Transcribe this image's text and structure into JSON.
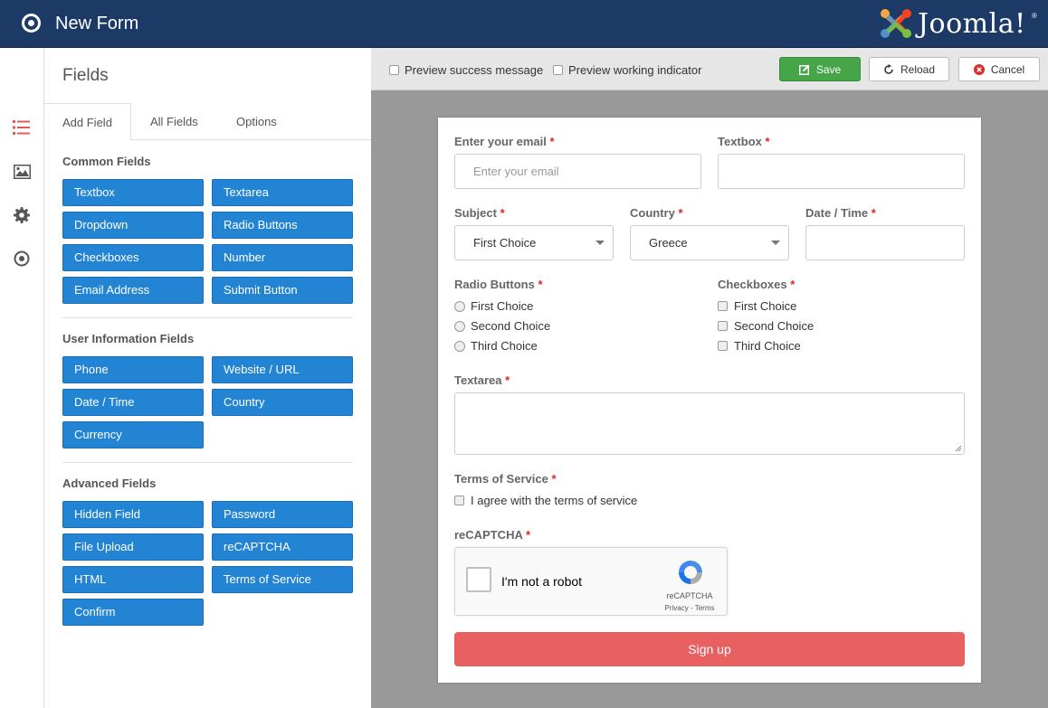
{
  "header": {
    "title": "New Form",
    "brand": "Joomla!",
    "brand_reg": "®"
  },
  "rail": {
    "items": [
      "fields-icon",
      "image-icon",
      "gear-icon",
      "target-icon"
    ]
  },
  "panel": {
    "title": "Fields",
    "tabs": [
      "Add Field",
      "All Fields",
      "Options"
    ],
    "sections": {
      "common": {
        "title": "Common Fields",
        "buttons": [
          "Textbox",
          "Textarea",
          "Dropdown",
          "Radio Buttons",
          "Checkboxes",
          "Number",
          "Email Address",
          "Submit Button"
        ]
      },
      "user": {
        "title": "User Information Fields",
        "buttons": [
          "Phone",
          "Website / URL",
          "Date / Time",
          "Country",
          "Currency"
        ]
      },
      "advanced": {
        "title": "Advanced Fields",
        "buttons": [
          "Hidden Field",
          "Password",
          "File Upload",
          "reCAPTCHA",
          "HTML",
          "Terms of Service",
          "Confirm"
        ]
      }
    }
  },
  "toolbar": {
    "preview_success": "Preview success message",
    "preview_working": "Preview working indicator",
    "save_label": "Save",
    "reload_label": "Reload",
    "cancel_label": "Cancel"
  },
  "form": {
    "email": {
      "label": "Enter your email",
      "placeholder": "Enter your email"
    },
    "textbox": {
      "label": "Textbox"
    },
    "subject": {
      "label": "Subject",
      "value": "First Choice"
    },
    "country": {
      "label": "Country",
      "value": "Greece"
    },
    "datetime": {
      "label": "Date / Time"
    },
    "radios": {
      "label": "Radio Buttons",
      "options": [
        "First Choice",
        "Second Choice",
        "Third Choice"
      ]
    },
    "checkboxes": {
      "label": "Checkboxes",
      "options": [
        "First Choice",
        "Second Choice",
        "Third Choice"
      ]
    },
    "textarea": {
      "label": "Textarea"
    },
    "tos": {
      "label": "Terms of Service",
      "text": "I agree with the terms of service"
    },
    "recaptcha": {
      "label": "reCAPTCHA",
      "checkbox_text": "I'm not a robot",
      "brand": "reCAPTCHA",
      "links": "Privacy - Terms"
    },
    "required_mark": "*",
    "submit_label": "Sign up"
  },
  "colors": {
    "header_bg": "#1d3a66",
    "field_button": "#2384d3",
    "save_green": "#46a546",
    "signup_red": "#e86060",
    "required_red": "#e02424"
  }
}
